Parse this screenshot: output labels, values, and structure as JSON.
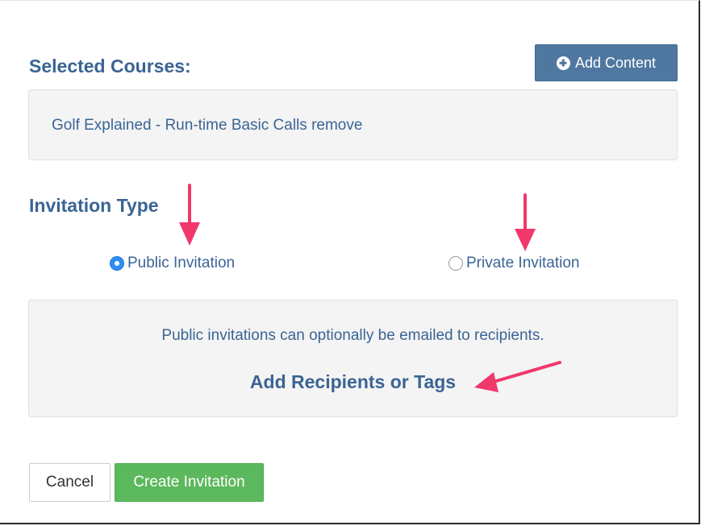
{
  "header": {
    "selected_courses_title": "Selected Courses:",
    "add_content_label": "Add Content"
  },
  "courses": [
    {
      "name": "Golf Explained - Run-time Basic Calls",
      "remove_label": "remove"
    }
  ],
  "invitation": {
    "title": "Invitation Type",
    "options": [
      {
        "label": "Public Invitation",
        "selected": true
      },
      {
        "label": "Private Invitation",
        "selected": false
      }
    ],
    "info_text": "Public invitations can optionally be emailed to recipients.",
    "add_recipients_label": "Add Recipients or Tags"
  },
  "footer": {
    "cancel_label": "Cancel",
    "create_label": "Create Invitation"
  },
  "colors": {
    "primary_text": "#3a6494",
    "add_button": "#4f77a0",
    "create_button": "#5cb85c",
    "radio_selected": "#2f8ef4",
    "annotation_arrow": "#f0386b"
  }
}
